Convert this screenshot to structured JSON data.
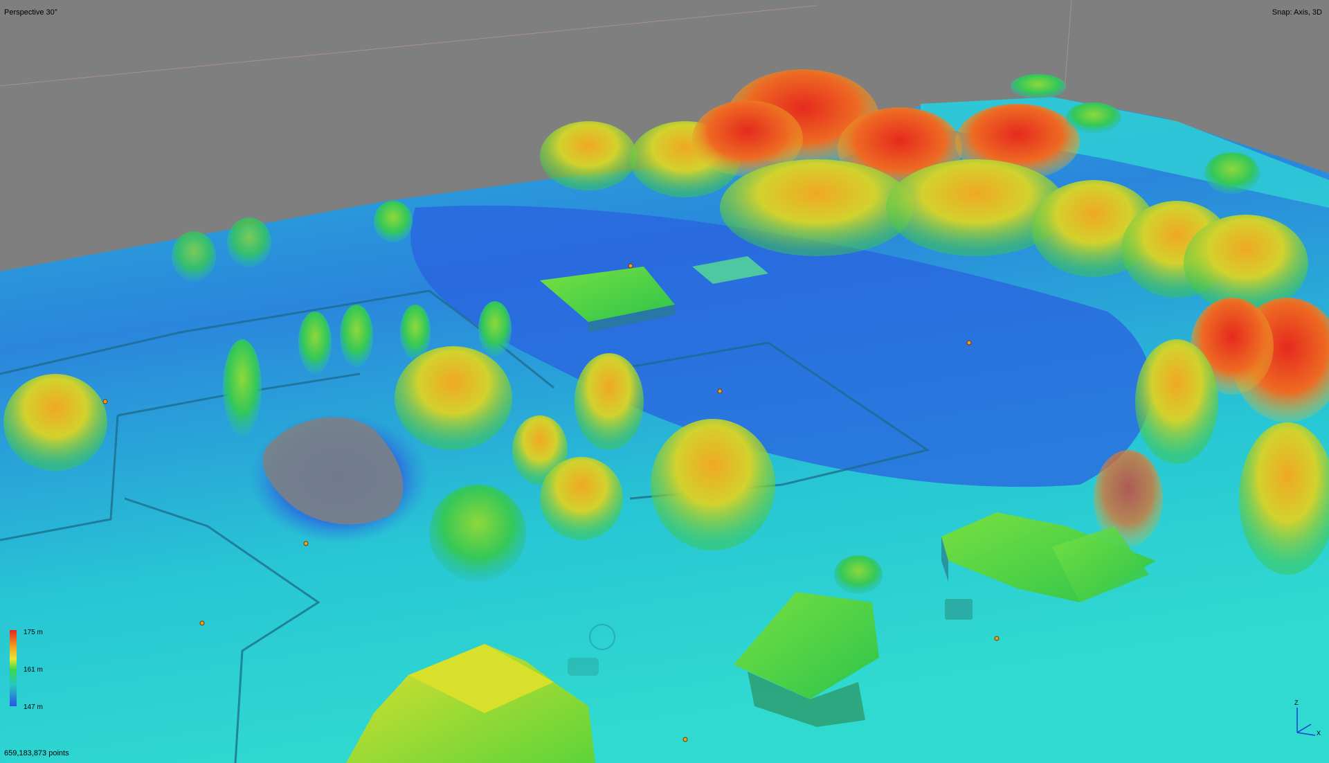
{
  "viewport": {
    "view_mode": "Perspective 30°",
    "snap_mode": "Snap: Axis, 3D",
    "point_count": "659,183,873 points"
  },
  "legend": {
    "max_label": "175 m",
    "mid_label": "161 m",
    "min_label": "147 m",
    "colors": [
      "#e5261f",
      "#f5a020",
      "#e8e830",
      "#38d84a",
      "#26c8c0",
      "#2a54e6"
    ]
  },
  "axis_gizmo": {
    "z_label": "Z",
    "x_label": "X"
  },
  "colors": {
    "background": "#808080",
    "ground_low": "#2a54e6",
    "ground_high": "#26d0d0",
    "canopy_high": "#e5261f"
  }
}
